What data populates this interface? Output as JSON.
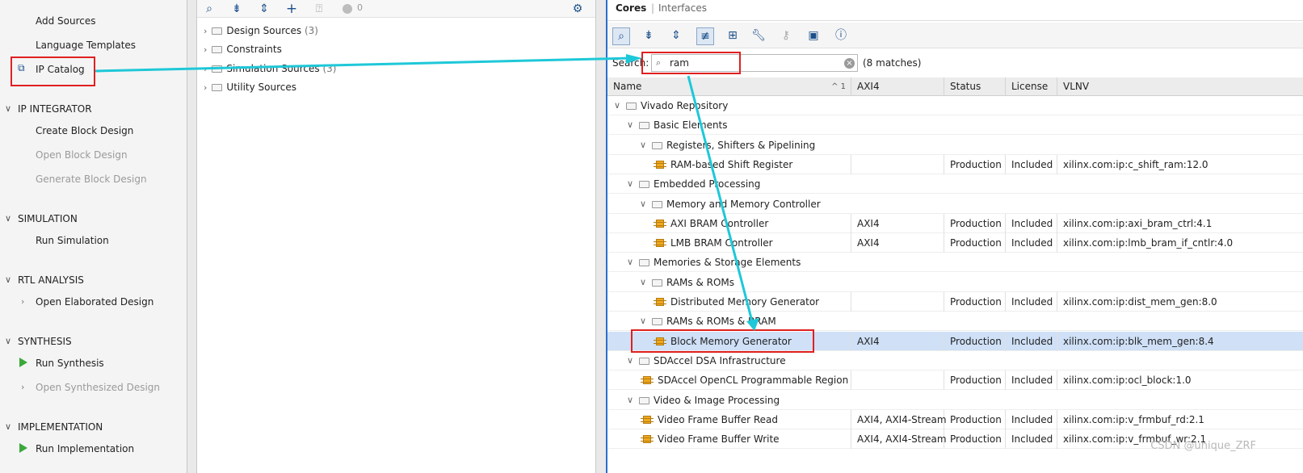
{
  "flow_nav": {
    "add_sources": "Add Sources",
    "language_templates": "Language Templates",
    "ip_catalog": "IP Catalog",
    "ip_integrator": "IP INTEGRATOR",
    "create_block_design": "Create Block Design",
    "open_block_design": "Open Block Design",
    "generate_block_design": "Generate Block Design",
    "simulation": "SIMULATION",
    "run_simulation": "Run Simulation",
    "rtl_analysis": "RTL ANALYSIS",
    "open_elaborated_design": "Open Elaborated Design",
    "synthesis": "SYNTHESIS",
    "run_synthesis": "Run Synthesis",
    "open_synthesized_design": "Open Synthesized Design",
    "implementation": "IMPLEMENTATION",
    "run_implementation": "Run Implementation"
  },
  "sources": {
    "status_count": "0",
    "items": [
      {
        "label": "Design Sources",
        "count": "(3)"
      },
      {
        "label": "Constraints",
        "count": ""
      },
      {
        "label": "Simulation Sources",
        "count": "(3)"
      },
      {
        "label": "Utility Sources",
        "count": ""
      }
    ]
  },
  "catalog": {
    "tabs": {
      "cores": "Cores",
      "interfaces": "Interfaces"
    },
    "search_label": "Search:",
    "search_value": "ram",
    "match_count": "(8 matches)",
    "columns": {
      "name": "Name",
      "sort_indicator": "^ 1",
      "axi4": "AXI4",
      "status": "Status",
      "license": "License",
      "vlnv": "VLNV"
    },
    "rows": [
      {
        "name": "Vivado Repository",
        "axi": "",
        "status": "",
        "license": "",
        "vlnv": ""
      },
      {
        "name": "Basic Elements",
        "axi": "",
        "status": "",
        "license": "",
        "vlnv": ""
      },
      {
        "name": "Registers, Shifters & Pipelining",
        "axi": "",
        "status": "",
        "license": "",
        "vlnv": ""
      },
      {
        "name": "RAM-based Shift Register",
        "axi": "",
        "status": "Production",
        "license": "Included",
        "vlnv": "xilinx.com:ip:c_shift_ram:12.0"
      },
      {
        "name": "Embedded Processing",
        "axi": "",
        "status": "",
        "license": "",
        "vlnv": ""
      },
      {
        "name": "Memory and Memory Controller",
        "axi": "",
        "status": "",
        "license": "",
        "vlnv": ""
      },
      {
        "name": "AXI BRAM Controller",
        "axi": "AXI4",
        "status": "Production",
        "license": "Included",
        "vlnv": "xilinx.com:ip:axi_bram_ctrl:4.1"
      },
      {
        "name": "LMB BRAM Controller",
        "axi": "AXI4",
        "status": "Production",
        "license": "Included",
        "vlnv": "xilinx.com:ip:lmb_bram_if_cntlr:4.0"
      },
      {
        "name": "Memories & Storage Elements",
        "axi": "",
        "status": "",
        "license": "",
        "vlnv": ""
      },
      {
        "name": "RAMs & ROMs",
        "axi": "",
        "status": "",
        "license": "",
        "vlnv": ""
      },
      {
        "name": "Distributed Memory Generator",
        "axi": "",
        "status": "Production",
        "license": "Included",
        "vlnv": "xilinx.com:ip:dist_mem_gen:8.0"
      },
      {
        "name": "RAMs & ROMs & BRAM",
        "axi": "",
        "status": "",
        "license": "",
        "vlnv": ""
      },
      {
        "name": "Block Memory Generator",
        "axi": "AXI4",
        "status": "Production",
        "license": "Included",
        "vlnv": "xilinx.com:ip:blk_mem_gen:8.4"
      },
      {
        "name": "SDAccel DSA Infrastructure",
        "axi": "",
        "status": "",
        "license": "",
        "vlnv": ""
      },
      {
        "name": "SDAccel OpenCL Programmable Region",
        "axi": "",
        "status": "Production",
        "license": "Included",
        "vlnv": "xilinx.com:ip:ocl_block:1.0"
      },
      {
        "name": "Video & Image Processing",
        "axi": "",
        "status": "",
        "license": "",
        "vlnv": ""
      },
      {
        "name": "Video Frame Buffer Read",
        "axi": "AXI4, AXI4-Stream",
        "status": "Production",
        "license": "Included",
        "vlnv": "xilinx.com:ip:v_frmbuf_rd:2.1"
      },
      {
        "name": "Video Frame Buffer Write",
        "axi": "AXI4, AXI4-Stream",
        "status": "Production",
        "license": "Included",
        "vlnv": "xilinx.com:ip:v_frmbuf_wr:2.1"
      }
    ]
  },
  "watermark": "CSDN @unique_ZRF",
  "colors": {
    "highlight_box": "#e02020",
    "arrow": "#1ec8d8",
    "selection": "#cfe0f7",
    "accent": "#2a6fcf"
  }
}
